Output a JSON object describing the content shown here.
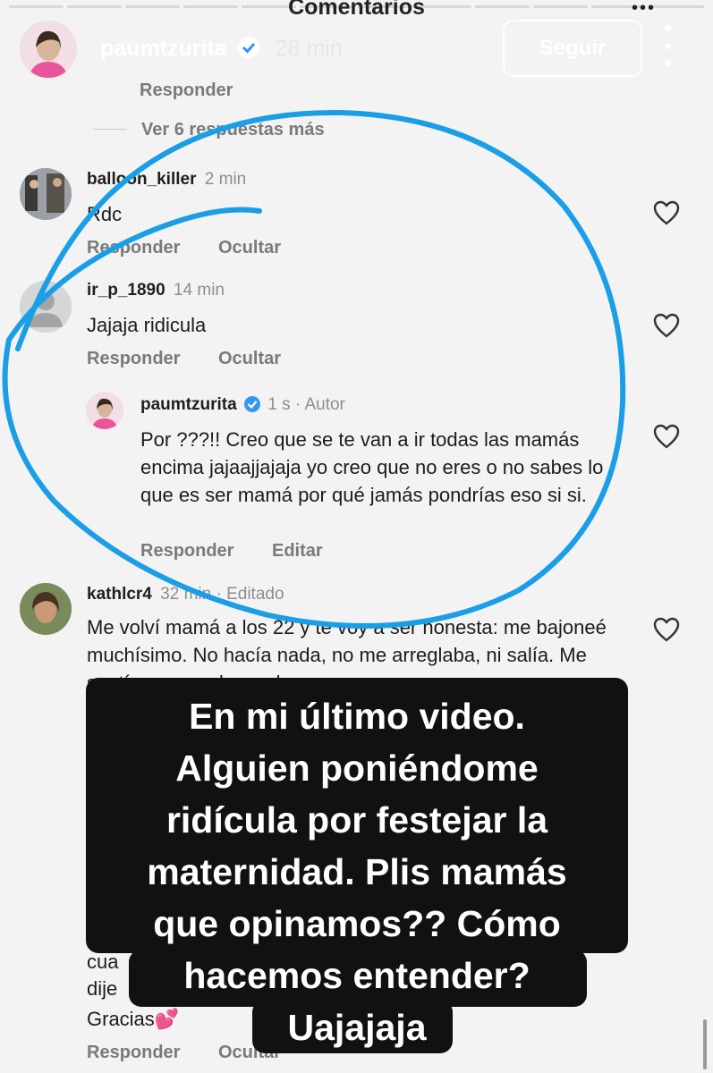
{
  "screen_title": "Comentarios",
  "more_dots": "•••",
  "header": {
    "username": "paumtzurita",
    "time": "28 min",
    "follow_label": "Seguir"
  },
  "replies_toggle": "Ver 6 respuestas más",
  "reply_label": "Responder",
  "hide_label": "Ocultar",
  "edit_label": "Editar",
  "comments": [
    {
      "username": "balloon_killer",
      "time": "2 min",
      "text": "Rdc"
    },
    {
      "username": "ir_p_1890",
      "time": "14 min",
      "text": "Jajaja ridicula"
    },
    {
      "username": "paumtzurita",
      "time": "1 s",
      "author_badge": "· Autor",
      "text": "Por ???!! Creo que se te van a ir todas las mamás encima jajaajjajaja yo creo que no eres o no sabes lo que es ser mamá por qué jamás pondrías eso si si."
    },
    {
      "username": "kathlcr4",
      "time": "32 min",
      "edited": "· Editado",
      "text": "Me volví mamá a los 22 y te voy a ser honesta: me bajoneé muchísimo. No hacía nada, no me arreglaba, ni salía. Me sentía encerrada y sola"
    }
  ],
  "partial_lines": [
    "cua",
    "dije"
  ],
  "thanks_text": "Gracias💕",
  "story_overlay": {
    "lines": [
      "En mi último video.",
      "Alguien poniéndome",
      "ridícula por festejar la",
      "maternidad. Plis mamás",
      "que opinamos?? Cómo",
      "hacemos entender?",
      "Uajajaja"
    ]
  },
  "colors": {
    "circle": "#1a9ee6",
    "background": "#f3f3f4",
    "overlay": "#111111",
    "verified": "#3797f0"
  }
}
